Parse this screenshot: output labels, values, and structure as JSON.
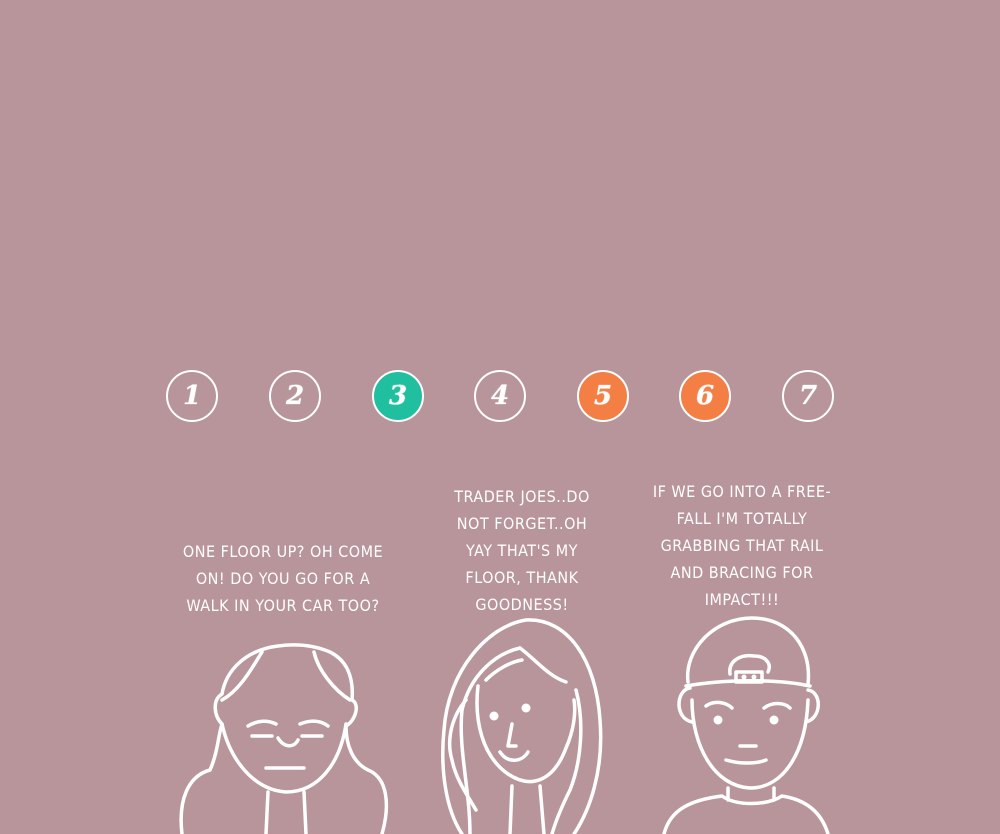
{
  "floor_buttons": [
    {
      "label": "1",
      "state": "off"
    },
    {
      "label": "2",
      "state": "off"
    },
    {
      "label": "3",
      "state": "teal"
    },
    {
      "label": "4",
      "state": "off"
    },
    {
      "label": "5",
      "state": "orange"
    },
    {
      "label": "6",
      "state": "orange"
    },
    {
      "label": "7",
      "state": "off"
    }
  ],
  "speech": {
    "left": "One floor up? Oh come on! Do you go for a walk in your car too?",
    "middle": "Trader Joes..do not forget..oh yay that's my floor, thank goodness!",
    "right": "If we go into a free-fall I'm totally grabbing that rail and bracing for impact!!!"
  },
  "colors": {
    "background": "#b8959b",
    "teal": "#1fbfa0",
    "orange": "#f47f45",
    "line": "#ffffff"
  }
}
